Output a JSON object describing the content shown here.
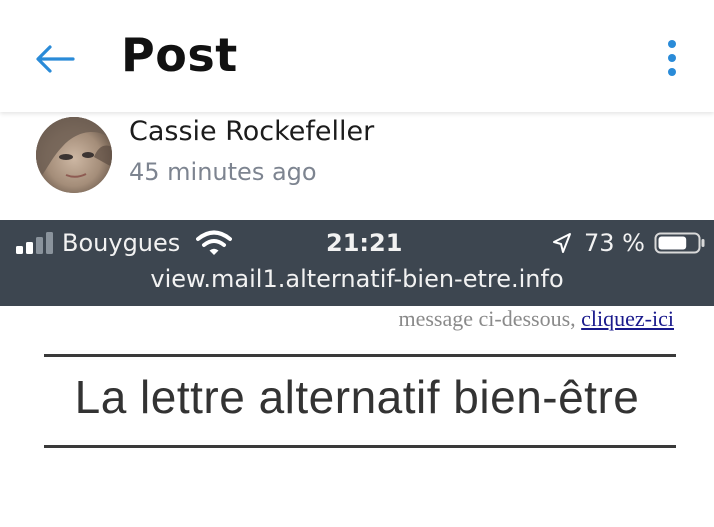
{
  "appbar": {
    "title": "Post",
    "back_icon": "arrow-left-icon",
    "more_icon": "more-vertical-icon",
    "accent_color": "#2a8bd8"
  },
  "post": {
    "author_name": "Cassie Rockefeller",
    "time_ago": "45 minutes ago"
  },
  "embedded_screenshot": {
    "status_bar": {
      "carrier": "Bouygues",
      "time": "21:21",
      "battery_percent": "73 %",
      "battery_level": 0.73,
      "background_color": "#3d4650"
    },
    "url": "view.mail1.alternatif-bien-etre.info",
    "message_text": "message ci-dessous, ",
    "message_link": "cliquez-ici",
    "newsletter_title": "La lettre alternatif bien-être"
  }
}
